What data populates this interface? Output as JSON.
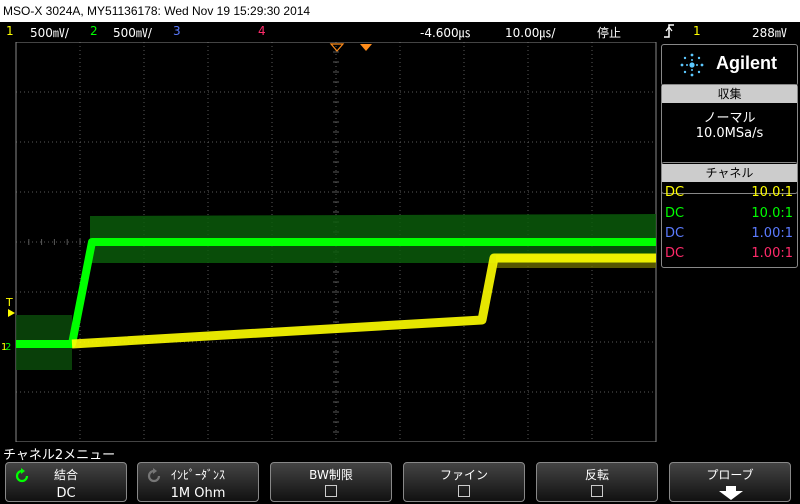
{
  "window": {
    "title": "MSO-X 3024A, MY51136178: Wed Nov 19 15:29:30 2014"
  },
  "status_bar": {
    "ch1_num": "1",
    "ch1_scale": "500㎷/",
    "ch2_num": "2",
    "ch2_scale": "500㎷/",
    "ch3_num": "3",
    "ch4_num": "4",
    "delay": "-4.600㎲",
    "timebase": "10.00㎲/",
    "run_state": "停止",
    "trig_icon": "trigger-edge-icon",
    "trig_source": "1",
    "trig_level": "288㎷"
  },
  "colors": {
    "ch1": "#ffff00",
    "ch2": "#00ff00",
    "ch3": "#5b7bff",
    "ch4": "#ff2a6a",
    "grid": "#5a5a5a",
    "trigger_marker": "#ff8c1a"
  },
  "screen": {
    "trig_level_marker": "T",
    "ch1_marker": "1",
    "ch2_marker": "2"
  },
  "panel": {
    "logo_icon": "agilent-spark-icon",
    "logo": "Agilent",
    "acq_header": "収集",
    "acq_mode": "ノーマル",
    "acq_rate": "10.0MSa/s",
    "channel_header": "チャネル",
    "channels": [
      {
        "coupling": "DC",
        "probe": "10.0:1"
      },
      {
        "coupling": "DC",
        "probe": "10.0:1"
      },
      {
        "coupling": "DC",
        "probe": "1.00:1"
      },
      {
        "coupling": "DC",
        "probe": "1.00:1"
      }
    ]
  },
  "menu": {
    "title": "チャネル2メニュー",
    "softkeys": [
      {
        "label": "結合",
        "value": "DC",
        "icon": "rotate-knob-icon"
      },
      {
        "label": "ｲﾝﾋﾟｰﾀﾞﾝｽ",
        "value": "1M Ohm",
        "icon": "rotate-knob-icon"
      },
      {
        "label": "BW制限"
      },
      {
        "label": "ファイン"
      },
      {
        "label": "反転"
      },
      {
        "label": "プローブ",
        "icon": "arrow-down-icon"
      }
    ]
  }
}
